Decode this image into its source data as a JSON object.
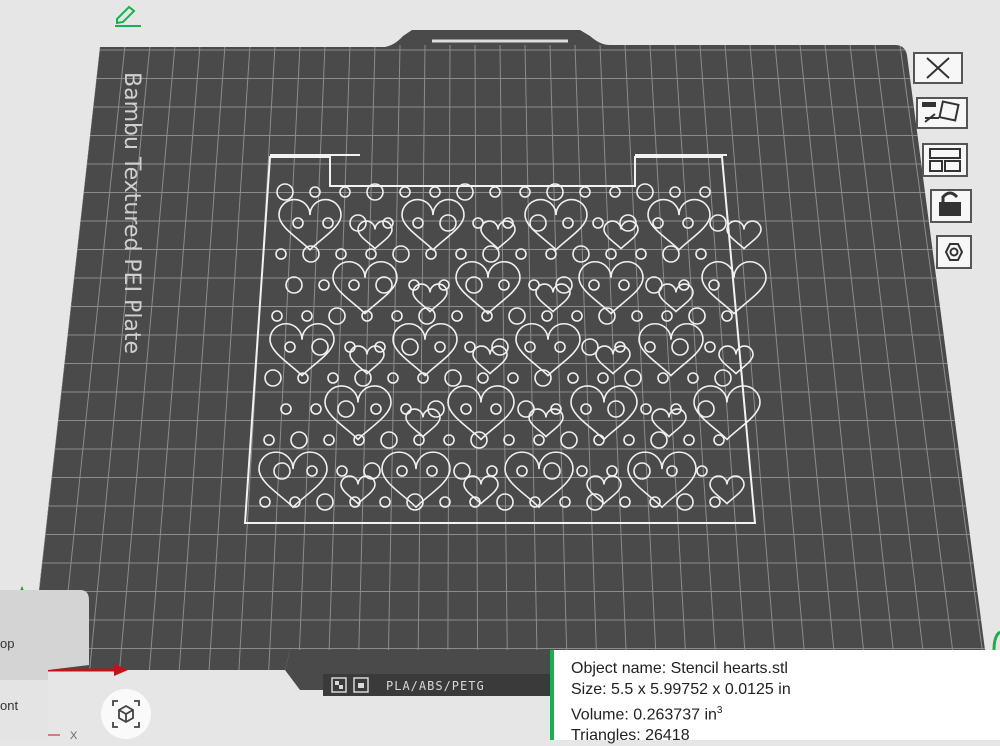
{
  "plate": {
    "name": "Bambu Textured PEI Plate",
    "filament_label": "PLA/ABS/PETG"
  },
  "view_cube": {
    "top_label": "op",
    "front_label": "ont",
    "x_axis_label": "X"
  },
  "object_info": {
    "name_line": "Object name: Stencil hearts.stl",
    "size_line": "Size: 5.5 x 5.99752 x 0.0125 in",
    "volume_prefix": "Volume: 0.263737 in",
    "volume_sup": "3",
    "triangles_line": "Triangles: 26418"
  },
  "icons": {
    "edit": "pencil-icon",
    "close": "close-icon",
    "auto_orient": "auto-orient-icon",
    "arrange": "arrange-icon",
    "lock": "lock-icon",
    "plate_settings": "hexagon-nut-icon",
    "reset_view": "cube-view-icon"
  },
  "colors": {
    "plate": "#4a4a4a",
    "grid": "#8c8c8c",
    "background": "#e6e6e6",
    "accent_green": "#18b04a",
    "axis_red": "#c0141a",
    "axis_green": "#18a030",
    "axis_blue": "#1a3fc8"
  }
}
